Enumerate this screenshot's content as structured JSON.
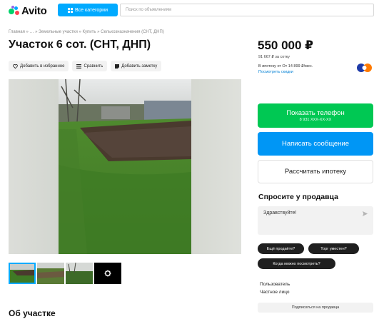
{
  "header": {
    "logo_text": "Avito",
    "categories_label": "Все категории",
    "search_placeholder": "Поиск по объявлениям"
  },
  "breadcrumbs": "Главная » … » Земельные участки » Купить » Сельхозназначения (СНТ, ДНП)",
  "listing": {
    "title": "Участок 6 сот. (СНТ, ДНП)",
    "actions": {
      "favorite": "Добавить в избранное",
      "compare": "Сравнить",
      "note": "Добавить заметку"
    },
    "about_heading": "Об участке"
  },
  "gallery": {
    "thumbnail_count": 4,
    "selected_thumbnail": 1,
    "more_icon": "more-photos-icon"
  },
  "pricing": {
    "price": "550 000 ₽",
    "per_sotka": "91 667 ₽ за сотку",
    "mortgage": "В ипотеку от От 14 899 ₽/мес.",
    "discount_link": "Посмотреть скидки"
  },
  "buttons": {
    "show_phone": "Показать телефон",
    "phone_mask": "8 931 XXX-XX-XX",
    "write_message": "Написать сообщение",
    "calc_mortgage": "Рассчитать ипотеку"
  },
  "ask_seller": {
    "heading": "Спросите у продавца",
    "input_value": "Здравствуйте!",
    "quick_questions": [
      "Ещё продаёте?",
      "Торг уместен?",
      "Когда можно посмотреть?"
    ]
  },
  "seller": {
    "name": "Пользователь",
    "type": "Частное лицо",
    "subscribe": "Подписаться на продавца"
  },
  "colors": {
    "brand_blue": "#00aaff",
    "green_button": "#00c853",
    "blue_button": "#0096f5",
    "chip_dark": "#1f1f1f"
  }
}
